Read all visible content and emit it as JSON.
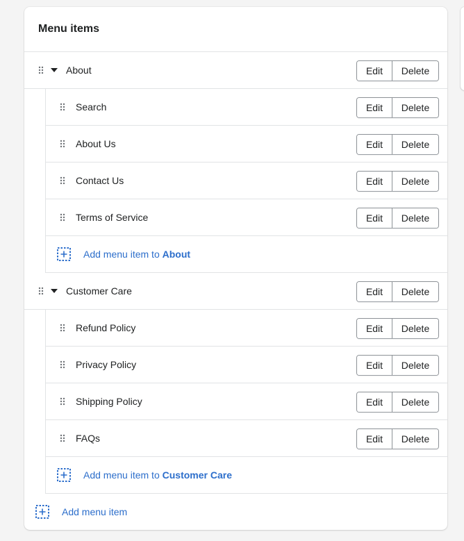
{
  "card": {
    "title": "Menu items"
  },
  "buttons": {
    "edit": "Edit",
    "delete": "Delete"
  },
  "groups": [
    {
      "label": "About",
      "children": [
        "Search",
        "About Us",
        "Contact Us",
        "Terms of Service"
      ],
      "add_prefix": "Add menu item to ",
      "add_target": "About"
    },
    {
      "label": "Customer Care",
      "children": [
        "Refund Policy",
        "Privacy Policy",
        "Shipping Policy",
        "FAQs"
      ],
      "add_prefix": "Add menu item to ",
      "add_target": "Customer Care"
    }
  ],
  "add_root_label": "Add menu item",
  "colors": {
    "link": "#2c6ecb",
    "border": "#e1e3e5",
    "text": "#202223"
  },
  "icons": {
    "drag": "drag-handle-icon",
    "caret": "caret-down-icon",
    "add": "add-dashed-icon"
  }
}
